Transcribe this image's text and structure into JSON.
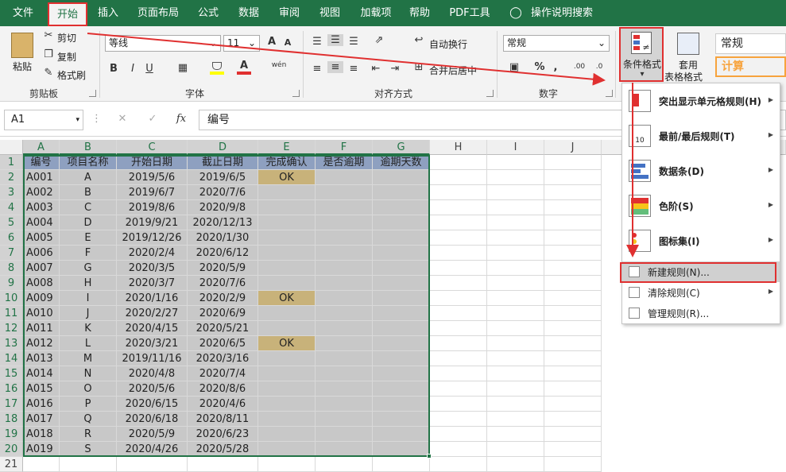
{
  "tabs": [
    "文件",
    "开始",
    "插入",
    "页面布局",
    "公式",
    "数据",
    "审阅",
    "视图",
    "加载项",
    "帮助",
    "PDF工具",
    "操作说明搜索"
  ],
  "clipboard": {
    "paste": "粘贴",
    "cut": "剪切",
    "copy": "复制",
    "format_painter": "格式刷",
    "group": "剪贴板"
  },
  "font": {
    "name": "等线",
    "size": "11",
    "group": "字体",
    "bold": "B",
    "italic": "I",
    "underline": "U",
    "grow": "A",
    "shrink": "A",
    "wen": "wén"
  },
  "alignment": {
    "wrap": "自动换行",
    "merge": "合并后居中",
    "group": "对齐方式"
  },
  "number": {
    "format": "常规",
    "group": "数字",
    "percent": "%",
    "comma": ",",
    "inc": ".00",
    "dec": ".0"
  },
  "styles": {
    "cond_format": "条件格式",
    "table_format_1": "套用",
    "table_format_2": "表格格式",
    "style_normal": "常规",
    "style_calc": "计算"
  },
  "namebox": "A1",
  "formula": "编号",
  "fx": "fx",
  "columns": [
    "A",
    "B",
    "C",
    "D",
    "E",
    "F",
    "G",
    "H",
    "I",
    "J"
  ],
  "rows": [
    "1",
    "2",
    "3",
    "4",
    "5",
    "6",
    "7",
    "8",
    "9",
    "10",
    "11",
    "12",
    "13",
    "14",
    "15",
    "16",
    "17",
    "18",
    "19",
    "20",
    "21"
  ],
  "headers": [
    "编号",
    "项目名称",
    "开始日期",
    "截止日期",
    "完成确认",
    "是否逾期",
    "逾期天数"
  ],
  "table": [
    [
      "A001",
      "A",
      "2019/5/6",
      "2019/6/5",
      "OK"
    ],
    [
      "A002",
      "B",
      "2019/6/7",
      "2020/7/6",
      ""
    ],
    [
      "A003",
      "C",
      "2019/8/6",
      "2020/9/8",
      ""
    ],
    [
      "A004",
      "D",
      "2019/9/21",
      "2020/12/13",
      ""
    ],
    [
      "A005",
      "E",
      "2019/12/26",
      "2020/1/30",
      ""
    ],
    [
      "A006",
      "F",
      "2020/2/4",
      "2020/6/12",
      ""
    ],
    [
      "A007",
      "G",
      "2020/3/5",
      "2020/5/9",
      ""
    ],
    [
      "A008",
      "H",
      "2020/3/7",
      "2020/7/6",
      ""
    ],
    [
      "A009",
      "I",
      "2020/1/16",
      "2020/2/9",
      "OK"
    ],
    [
      "A010",
      "J",
      "2020/2/27",
      "2020/6/9",
      ""
    ],
    [
      "A011",
      "K",
      "2020/4/15",
      "2020/5/21",
      ""
    ],
    [
      "A012",
      "L",
      "2020/3/21",
      "2020/6/5",
      "OK"
    ],
    [
      "A013",
      "M",
      "2019/11/16",
      "2020/3/16",
      ""
    ],
    [
      "A014",
      "N",
      "2020/4/8",
      "2020/7/4",
      ""
    ],
    [
      "A015",
      "O",
      "2020/5/6",
      "2020/8/6",
      ""
    ],
    [
      "A016",
      "P",
      "2020/6/15",
      "2020/4/6",
      ""
    ],
    [
      "A017",
      "Q",
      "2020/6/18",
      "2020/8/11",
      ""
    ],
    [
      "A018",
      "R",
      "2020/5/9",
      "2020/6/23",
      ""
    ],
    [
      "A019",
      "S",
      "2020/4/26",
      "2020/5/28",
      ""
    ]
  ],
  "menu": [
    {
      "label": "突出显示单元格规则(H)",
      "arrow": true
    },
    {
      "label": "最前/最后规则(T)",
      "arrow": true
    },
    {
      "label": "数据条(D)",
      "arrow": true
    },
    {
      "label": "色阶(S)",
      "arrow": true
    },
    {
      "label": "图标集(I)",
      "arrow": true
    },
    {
      "label": "新建规则(N)...",
      "arrow": false
    },
    {
      "label": "清除规则(C)",
      "arrow": true
    },
    {
      "label": "管理规则(R)...",
      "arrow": false
    }
  ],
  "icon_glyphs": {
    "arrow_right": "▶",
    "dropdown": "▾",
    "top10": "10",
    "neq": "≠",
    "cancel": "✕",
    "enter": "✓"
  },
  "colors": {
    "ribbon_green": "#217346",
    "highlight_red": "#e03030",
    "ok_fill": "#c8b27a",
    "sel_fill": "#c8c8c8"
  }
}
